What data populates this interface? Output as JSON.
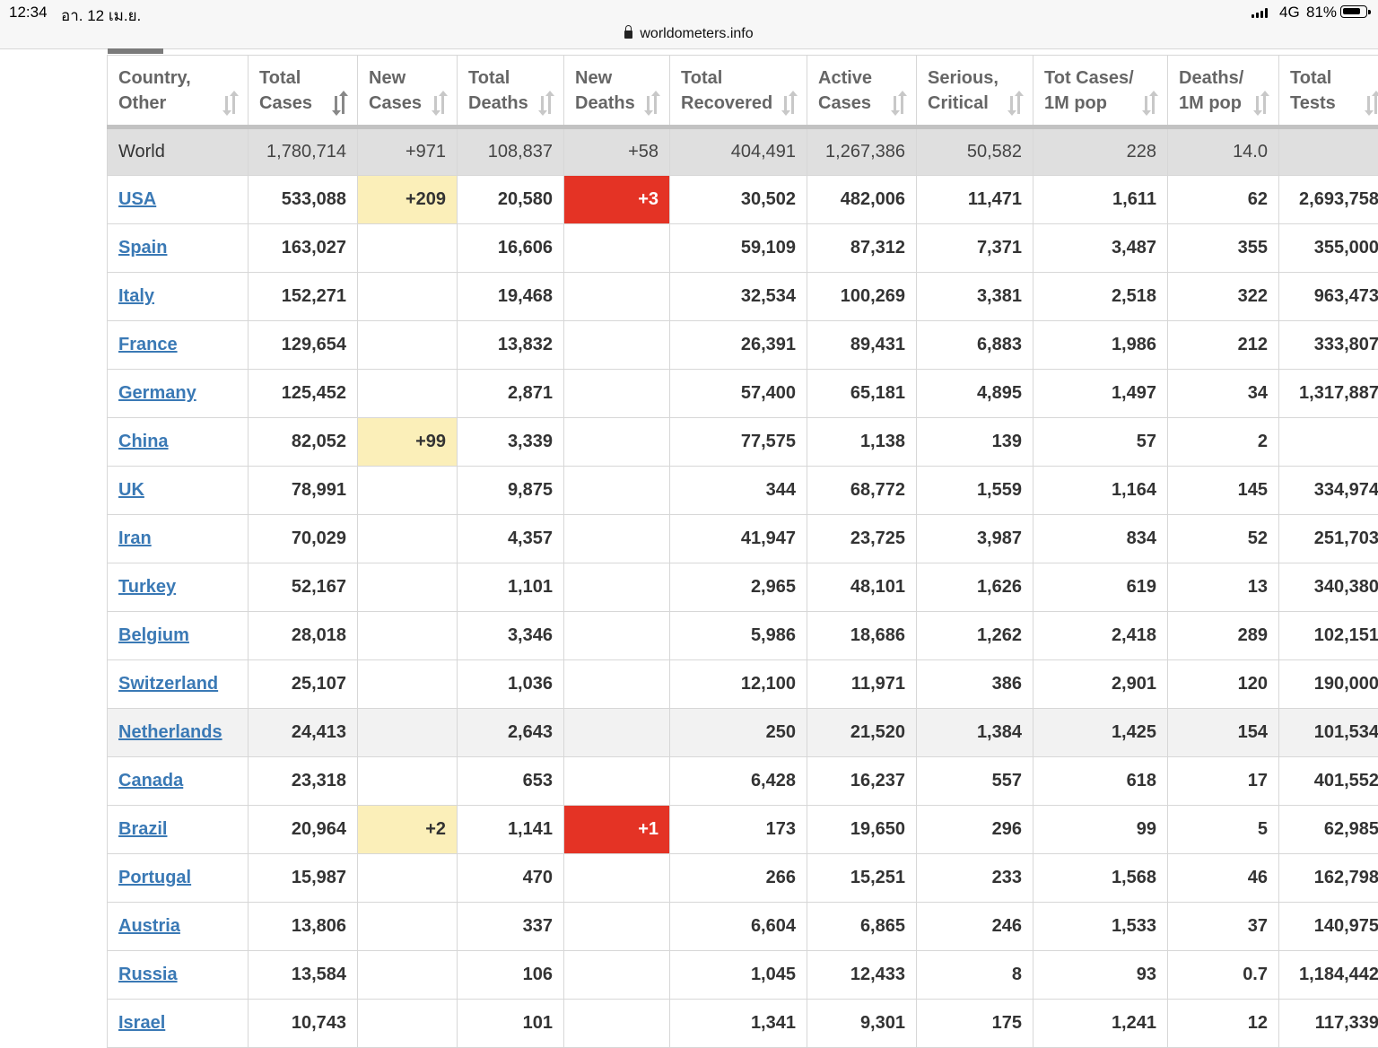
{
  "status_bar": {
    "time": "12:34",
    "date": "อา. 12 เม.ย.",
    "network": "4G",
    "battery_percent": "81%",
    "battery_level": 0.81
  },
  "url_bar": {
    "url": "worldometers.info"
  },
  "colors": {
    "link": "#3a79b5",
    "new_cases_bg": "#fbefb9",
    "new_deaths_bg": "#e43325",
    "world_row_bg": "#dfdfdf"
  },
  "table": {
    "headers": [
      {
        "l1": "Country,",
        "l2": "Other",
        "active": false
      },
      {
        "l1": "Total",
        "l2": "Cases",
        "active": true
      },
      {
        "l1": "New",
        "l2": "Cases",
        "active": false
      },
      {
        "l1": "Total",
        "l2": "Deaths",
        "active": false
      },
      {
        "l1": "New",
        "l2": "Deaths",
        "active": false
      },
      {
        "l1": "Total",
        "l2": "Recovered",
        "active": false
      },
      {
        "l1": "Active",
        "l2": "Cases",
        "active": false
      },
      {
        "l1": "Serious,",
        "l2": "Critical",
        "active": false
      },
      {
        "l1": "Tot Cases/",
        "l2": "1M pop",
        "active": false
      },
      {
        "l1": "Deaths/",
        "l2": "1M pop",
        "active": false
      },
      {
        "l1": "Total",
        "l2": "Tests",
        "active": false
      }
    ],
    "world": {
      "country": "World",
      "total_cases": "1,780,714",
      "new_cases": "+971",
      "total_deaths": "108,837",
      "new_deaths": "+58",
      "total_recovered": "404,491",
      "active_cases": "1,267,386",
      "serious_critical": "50,582",
      "cases_per_1m": "228",
      "deaths_per_1m": "14.0",
      "total_tests": ""
    },
    "rows": [
      {
        "country": "USA",
        "total_cases": "533,088",
        "new_cases": "+209",
        "total_deaths": "20,580",
        "new_deaths": "+3",
        "total_recovered": "30,502",
        "active_cases": "482,006",
        "serious_critical": "11,471",
        "cases_per_1m": "1,611",
        "deaths_per_1m": "62",
        "total_tests": "2,693,758"
      },
      {
        "country": "Spain",
        "total_cases": "163,027",
        "new_cases": "",
        "total_deaths": "16,606",
        "new_deaths": "",
        "total_recovered": "59,109",
        "active_cases": "87,312",
        "serious_critical": "7,371",
        "cases_per_1m": "3,487",
        "deaths_per_1m": "355",
        "total_tests": "355,000"
      },
      {
        "country": "Italy",
        "total_cases": "152,271",
        "new_cases": "",
        "total_deaths": "19,468",
        "new_deaths": "",
        "total_recovered": "32,534",
        "active_cases": "100,269",
        "serious_critical": "3,381",
        "cases_per_1m": "2,518",
        "deaths_per_1m": "322",
        "total_tests": "963,473"
      },
      {
        "country": "France",
        "total_cases": "129,654",
        "new_cases": "",
        "total_deaths": "13,832",
        "new_deaths": "",
        "total_recovered": "26,391",
        "active_cases": "89,431",
        "serious_critical": "6,883",
        "cases_per_1m": "1,986",
        "deaths_per_1m": "212",
        "total_tests": "333,807"
      },
      {
        "country": "Germany",
        "total_cases": "125,452",
        "new_cases": "",
        "total_deaths": "2,871",
        "new_deaths": "",
        "total_recovered": "57,400",
        "active_cases": "65,181",
        "serious_critical": "4,895",
        "cases_per_1m": "1,497",
        "deaths_per_1m": "34",
        "total_tests": "1,317,887"
      },
      {
        "country": "China",
        "total_cases": "82,052",
        "new_cases": "+99",
        "total_deaths": "3,339",
        "new_deaths": "",
        "total_recovered": "77,575",
        "active_cases": "1,138",
        "serious_critical": "139",
        "cases_per_1m": "57",
        "deaths_per_1m": "2",
        "total_tests": ""
      },
      {
        "country": "UK",
        "total_cases": "78,991",
        "new_cases": "",
        "total_deaths": "9,875",
        "new_deaths": "",
        "total_recovered": "344",
        "active_cases": "68,772",
        "serious_critical": "1,559",
        "cases_per_1m": "1,164",
        "deaths_per_1m": "145",
        "total_tests": "334,974"
      },
      {
        "country": "Iran",
        "total_cases": "70,029",
        "new_cases": "",
        "total_deaths": "4,357",
        "new_deaths": "",
        "total_recovered": "41,947",
        "active_cases": "23,725",
        "serious_critical": "3,987",
        "cases_per_1m": "834",
        "deaths_per_1m": "52",
        "total_tests": "251,703"
      },
      {
        "country": "Turkey",
        "total_cases": "52,167",
        "new_cases": "",
        "total_deaths": "1,101",
        "new_deaths": "",
        "total_recovered": "2,965",
        "active_cases": "48,101",
        "serious_critical": "1,626",
        "cases_per_1m": "619",
        "deaths_per_1m": "13",
        "total_tests": "340,380"
      },
      {
        "country": "Belgium",
        "total_cases": "28,018",
        "new_cases": "",
        "total_deaths": "3,346",
        "new_deaths": "",
        "total_recovered": "5,986",
        "active_cases": "18,686",
        "serious_critical": "1,262",
        "cases_per_1m": "2,418",
        "deaths_per_1m": "289",
        "total_tests": "102,151"
      },
      {
        "country": "Switzerland",
        "total_cases": "25,107",
        "new_cases": "",
        "total_deaths": "1,036",
        "new_deaths": "",
        "total_recovered": "12,100",
        "active_cases": "11,971",
        "serious_critical": "386",
        "cases_per_1m": "2,901",
        "deaths_per_1m": "120",
        "total_tests": "190,000"
      },
      {
        "country": "Netherlands",
        "total_cases": "24,413",
        "new_cases": "",
        "total_deaths": "2,643",
        "new_deaths": "",
        "total_recovered": "250",
        "active_cases": "21,520",
        "serious_critical": "1,384",
        "cases_per_1m": "1,425",
        "deaths_per_1m": "154",
        "total_tests": "101,534"
      },
      {
        "country": "Canada",
        "total_cases": "23,318",
        "new_cases": "",
        "total_deaths": "653",
        "new_deaths": "",
        "total_recovered": "6,428",
        "active_cases": "16,237",
        "serious_critical": "557",
        "cases_per_1m": "618",
        "deaths_per_1m": "17",
        "total_tests": "401,552"
      },
      {
        "country": "Brazil",
        "total_cases": "20,964",
        "new_cases": "+2",
        "total_deaths": "1,141",
        "new_deaths": "+1",
        "total_recovered": "173",
        "active_cases": "19,650",
        "serious_critical": "296",
        "cases_per_1m": "99",
        "deaths_per_1m": "5",
        "total_tests": "62,985"
      },
      {
        "country": "Portugal",
        "total_cases": "15,987",
        "new_cases": "",
        "total_deaths": "470",
        "new_deaths": "",
        "total_recovered": "266",
        "active_cases": "15,251",
        "serious_critical": "233",
        "cases_per_1m": "1,568",
        "deaths_per_1m": "46",
        "total_tests": "162,798"
      },
      {
        "country": "Austria",
        "total_cases": "13,806",
        "new_cases": "",
        "total_deaths": "337",
        "new_deaths": "",
        "total_recovered": "6,604",
        "active_cases": "6,865",
        "serious_critical": "246",
        "cases_per_1m": "1,533",
        "deaths_per_1m": "37",
        "total_tests": "140,975"
      },
      {
        "country": "Russia",
        "total_cases": "13,584",
        "new_cases": "",
        "total_deaths": "106",
        "new_deaths": "",
        "total_recovered": "1,045",
        "active_cases": "12,433",
        "serious_critical": "8",
        "cases_per_1m": "93",
        "deaths_per_1m": "0.7",
        "total_tests": "1,184,442"
      },
      {
        "country": "Israel",
        "total_cases": "10,743",
        "new_cases": "",
        "total_deaths": "101",
        "new_deaths": "",
        "total_recovered": "1,341",
        "active_cases": "9,301",
        "serious_critical": "175",
        "cases_per_1m": "1,241",
        "deaths_per_1m": "12",
        "total_tests": "117,339"
      }
    ]
  }
}
